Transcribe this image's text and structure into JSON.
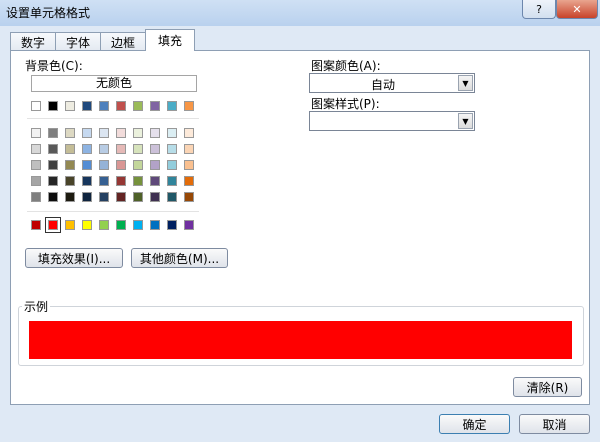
{
  "window": {
    "title": "设置单元格格式",
    "help_label": "?",
    "close_label": "✕"
  },
  "tabs": [
    {
      "label": "数字",
      "active": false
    },
    {
      "label": "字体",
      "active": false
    },
    {
      "label": "边框",
      "active": false
    },
    {
      "label": "填充",
      "active": true
    }
  ],
  "background_color": {
    "label": "背景色(C):",
    "no_color_label": "无颜色",
    "theme_row": [
      "#ffffff",
      "#000000",
      "#eeece1",
      "#1f497d",
      "#4f81bd",
      "#c0504d",
      "#9bbb59",
      "#8064a2",
      "#4bacc6",
      "#f79646"
    ],
    "tint_rows": [
      [
        "#f2f2f2",
        "#7f7f7f",
        "#ddd9c3",
        "#c6d9f0",
        "#dbe5f1",
        "#f2dcdb",
        "#ebf1dd",
        "#e5e0ec",
        "#dbeef3",
        "#fdeada"
      ],
      [
        "#d8d8d8",
        "#595959",
        "#c4bd97",
        "#8db3e2",
        "#b8cce4",
        "#e5b9b7",
        "#d7e3bc",
        "#ccc1d9",
        "#b7dde8",
        "#fbd5b5"
      ],
      [
        "#bfbfbf",
        "#3f3f3f",
        "#938953",
        "#548dd4",
        "#95b3d7",
        "#d99694",
        "#c3d69b",
        "#b2a2c7",
        "#92cddc",
        "#fac08f"
      ],
      [
        "#a5a5a5",
        "#262626",
        "#494429",
        "#17365d",
        "#366092",
        "#953734",
        "#76923c",
        "#5f497a",
        "#31859b",
        "#e36c09"
      ],
      [
        "#7f7f7f",
        "#0c0c0c",
        "#1d1b10",
        "#0f243e",
        "#244061",
        "#632423",
        "#4f6128",
        "#3f3151",
        "#205867",
        "#974806"
      ]
    ],
    "standard_row": [
      "#c00000",
      "#ff0000",
      "#ffc000",
      "#ffff00",
      "#92d050",
      "#00b050",
      "#00b0f0",
      "#0070c0",
      "#002060",
      "#7030a0"
    ],
    "selected_color": "#ff0000"
  },
  "buttons": {
    "fill_effects": "填充效果(I)...",
    "more_colors": "其他颜色(M)...",
    "clear": "清除(R)",
    "ok": "确定",
    "cancel": "取消"
  },
  "pattern_color": {
    "label": "图案颜色(A):",
    "value": "自动"
  },
  "pattern_style": {
    "label": "图案样式(P):",
    "value": ""
  },
  "sample": {
    "label": "示例",
    "color": "#ff0000"
  }
}
